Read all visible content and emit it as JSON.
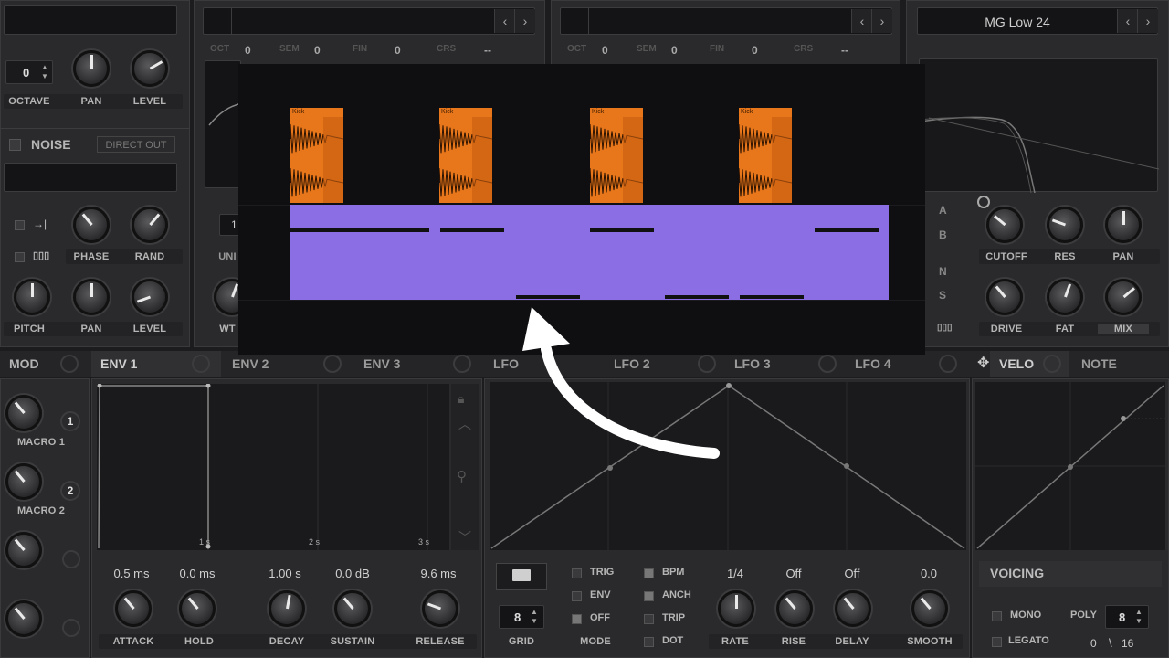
{
  "osc": {
    "octave_value": "0",
    "knob_labels": [
      "OCTAVE",
      "PAN",
      "LEVEL"
    ],
    "noise_label": "NOISE",
    "direct_out_label": "DIRECT OUT",
    "row2_labels": [
      "PHASE",
      "RAND"
    ],
    "row3_labels": [
      "PITCH",
      "PAN",
      "LEVEL"
    ],
    "unison_partial": "UNI",
    "wt_partial": "WT"
  },
  "osc_b": {
    "oct_label": "OCT",
    "oct_value": "0",
    "sem_label": "SEM",
    "sem_value": "0",
    "fin_label": "FIN",
    "fin_value": "0",
    "crs_label": "CRS",
    "crs_value": "--"
  },
  "osc_c": {
    "oct_label": "OCT",
    "oct_value": "0",
    "sem_label": "SEM",
    "sem_value": "0",
    "fin_label": "FIN",
    "fin_value": "0",
    "crs_label": "CRS",
    "crs_value": "--"
  },
  "filter": {
    "preset_name": "MG Low 24",
    "routing": [
      "A",
      "B",
      "N",
      "S"
    ],
    "knob_labels_row1": [
      "CUTOFF",
      "RES",
      "PAN"
    ],
    "knob_labels_row2": [
      "DRIVE",
      "FAT",
      "MIX"
    ]
  },
  "overlay": {
    "clip_name": "Kick",
    "clip_count": 4,
    "accent_clip": "#e8761a",
    "accent_roll": "#8b6ee3"
  },
  "mod_tabs": {
    "mod": "MOD",
    "env1": "ENV 1",
    "env2": "ENV 2",
    "env3": "ENV 3",
    "lfo1": "LFO",
    "lfo2": "LFO 2",
    "lfo3": "LFO 3",
    "lfo4": "LFO 4",
    "velo": "VELO",
    "note": "NOTE"
  },
  "macros": [
    {
      "label": "MACRO 1",
      "num": "1"
    },
    {
      "label": "MACRO 2",
      "num": "2"
    }
  ],
  "env": {
    "time_ticks": [
      "1 s",
      "2 s",
      "3 s"
    ],
    "values": [
      "0.5 ms",
      "0.0 ms",
      "1.00 s",
      "0.0 dB",
      "9.6 ms"
    ],
    "labels": [
      "ATTACK",
      "HOLD",
      "DECAY",
      "SUSTAIN",
      "RELEASE"
    ]
  },
  "lfo": {
    "grid_value": "8",
    "grid_label": "GRID",
    "mode_options": [
      "TRIG",
      "ENV",
      "OFF"
    ],
    "mode_label": "MODE",
    "flags": [
      "BPM",
      "ANCH",
      "TRIP",
      "DOT"
    ],
    "values": [
      "1/4",
      "Off",
      "Off",
      "0.0"
    ],
    "labels": [
      "RATE",
      "RISE",
      "DELAY",
      "SMOOTH"
    ]
  },
  "voicing": {
    "title": "VOICING",
    "mono": "MONO",
    "legato": "LEGATO",
    "poly_label": "POLY",
    "poly_value": "8",
    "legato_value": "0",
    "legato_value2": "16"
  }
}
